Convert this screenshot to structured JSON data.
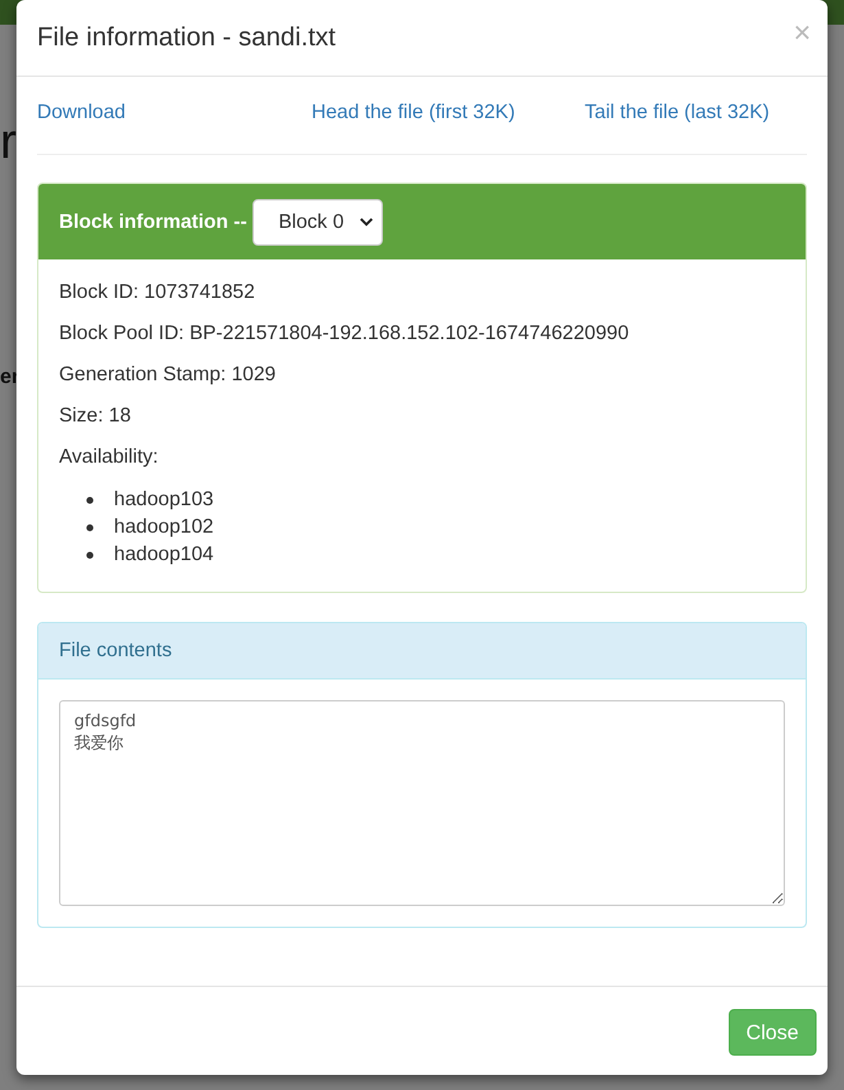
{
  "background": {
    "heading": "r",
    "column_header": "er"
  },
  "modal": {
    "title": "File information - sandi.txt",
    "close_icon": "×",
    "links": [
      "Download",
      "Head the file (first 32K)",
      "Tail the file (last 32K)"
    ],
    "block_panel": {
      "title": "Block information --",
      "block_select": {
        "value": "Block 0"
      },
      "fields": [
        "Block ID: 1073741852",
        "Block Pool ID: BP-221571804-192.168.152.102-1674746220990",
        "Generation Stamp: 1029",
        "Size: 18",
        "Availability:"
      ],
      "availability": [
        "hadoop103",
        "hadoop102",
        "hadoop104"
      ]
    },
    "contents_panel": {
      "title": "File contents",
      "value": "gfdsgfd\n我爱你"
    },
    "footer_button": "Close"
  }
}
